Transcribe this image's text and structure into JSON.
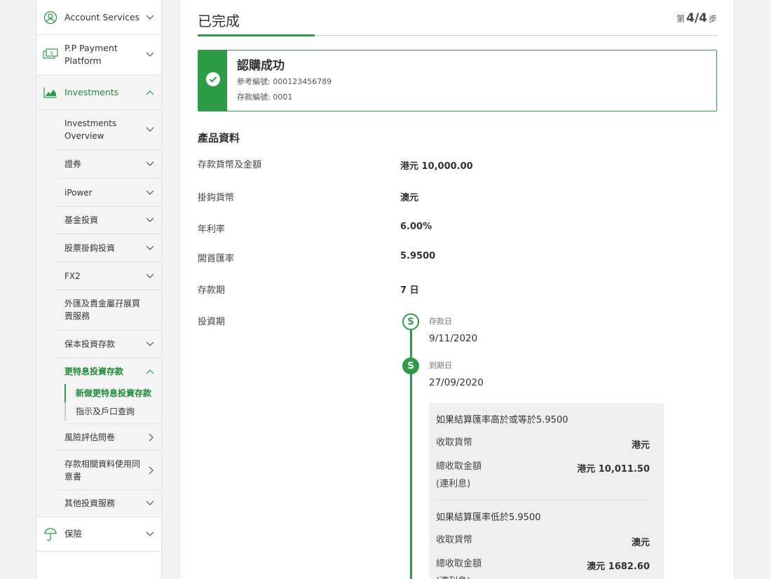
{
  "sidebar": {
    "top_items": [
      {
        "label": "Account Services",
        "icon": "user-circle-icon"
      },
      {
        "label": "P.P Payment Platform",
        "icon": "payment-icon"
      },
      {
        "label": "Investments",
        "icon": "chart-icon"
      }
    ],
    "sub_items": [
      {
        "label": "Investments Overview"
      },
      {
        "label": "證券"
      },
      {
        "label": "iPower"
      },
      {
        "label": "基金投資"
      },
      {
        "label": "股票掛鈎投資"
      },
      {
        "label": "FX2"
      },
      {
        "label": "外匯及貴金屬孖展買賣服務"
      },
      {
        "label": "保本投資存款"
      },
      {
        "label": "更特息投資存款"
      }
    ],
    "leaf_items": [
      {
        "label": "新做更特息投資存款"
      },
      {
        "label": "指示及戶口查詢"
      }
    ],
    "sub_items_after": [
      {
        "label": "風險評估問卷"
      },
      {
        "label": "存款相關資料使用同意書"
      },
      {
        "label": "其他投資服務"
      }
    ],
    "bottom_items": [
      {
        "label": "保險",
        "icon": "umbrella-icon"
      }
    ]
  },
  "step": {
    "title": "已完成",
    "prefix": "第",
    "current": "4/4",
    "suffix": "步"
  },
  "success": {
    "title": "認購成功",
    "ref_label": "參考編號: 000123456789",
    "deposit_label": "存款編號: 0001"
  },
  "product": {
    "section_title": "產品資料",
    "rows": [
      {
        "label": "存款貨幣及金額",
        "value": "港元 10,000.00"
      },
      {
        "label": "掛鈎貨幣",
        "value": "澳元"
      },
      {
        "label": "年利率",
        "value": "6.00%"
      },
      {
        "label": "開首匯率",
        "value": "5.9500"
      },
      {
        "label": "存款期",
        "value": "7 日"
      },
      {
        "label": "投資期",
        "value": ""
      }
    ]
  },
  "timeline": {
    "start_caption": "存款日",
    "start_date": "9/11/2020",
    "end_caption": "到期日",
    "end_date": "27/09/2020",
    "icon_glyph": "S"
  },
  "scenarios": [
    {
      "heading": "如果結算匯率高於或等於5.9500",
      "currency_label": "收取貨幣",
      "currency_value": "港元",
      "total_label": "總收取金額",
      "total_sub": "(連利息)",
      "total_value": "港元 10,011.50"
    },
    {
      "heading": "如果結算匯率低於5.9500",
      "currency_label": "收取貨幣",
      "currency_value": "澳元",
      "total_label": "總收取金額",
      "total_sub": "(連利息)",
      "total_value": "澳元 1682.60"
    }
  ],
  "colors": {
    "accent": "#2e9b47"
  }
}
